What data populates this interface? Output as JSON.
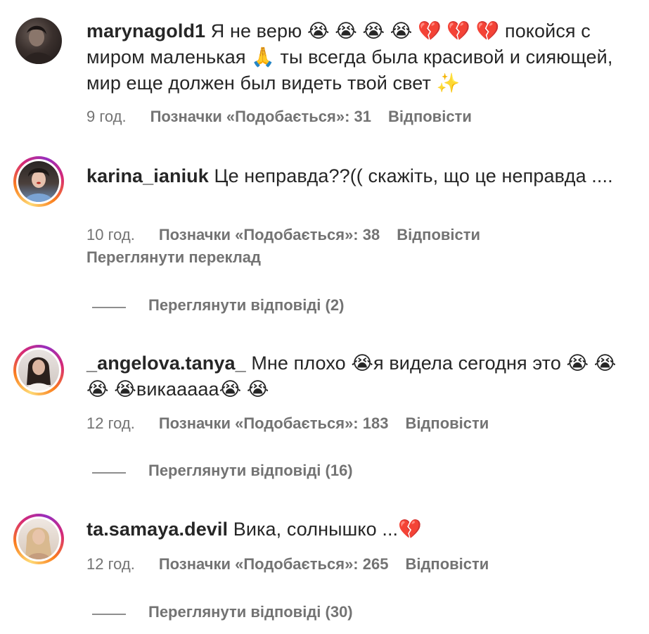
{
  "comments": [
    {
      "username": "marynagold1",
      "text": " Я не верю 😭 😭 😭 😭 💔 💔 💔  покойся с миром маленькая 🙏  ты всегда была красивой и сияющей, мир еще должен был видеть твой свет ✨",
      "time": "9 год.",
      "likes": "Позначки «Подобається»: 31",
      "reply": "Відповісти",
      "avatar": "dark-photo"
    },
    {
      "username": "karina_ianiuk",
      "text": " Це неправда??(( скажіть, що це неправда ....",
      "time": "10 год.",
      "likes": "Позначки «Подобається»: 38",
      "reply": "Відповісти",
      "translate": "Переглянути переклад",
      "replies": "Переглянути відповіді (2)",
      "avatar": "story-ring"
    },
    {
      "username": "_angelova.tanya_",
      "text": " Мне плохо 😭я видела сегодня это 😭 😭 😭 😭викаааaa😭 😭",
      "time": "12 год.",
      "likes": "Позначки «Подобається»: 183",
      "reply": "Відповісти",
      "replies": "Переглянути відповіді (16)",
      "avatar": "story-ring"
    },
    {
      "username": "ta.samaya.devil",
      "text": " Вика, солнышко ...💔",
      "time": "12 год.",
      "likes": "Позначки «Подобається»: 265",
      "reply": "Відповісти",
      "replies": "Переглянути відповіді (30)",
      "avatar": "story-ring"
    }
  ]
}
